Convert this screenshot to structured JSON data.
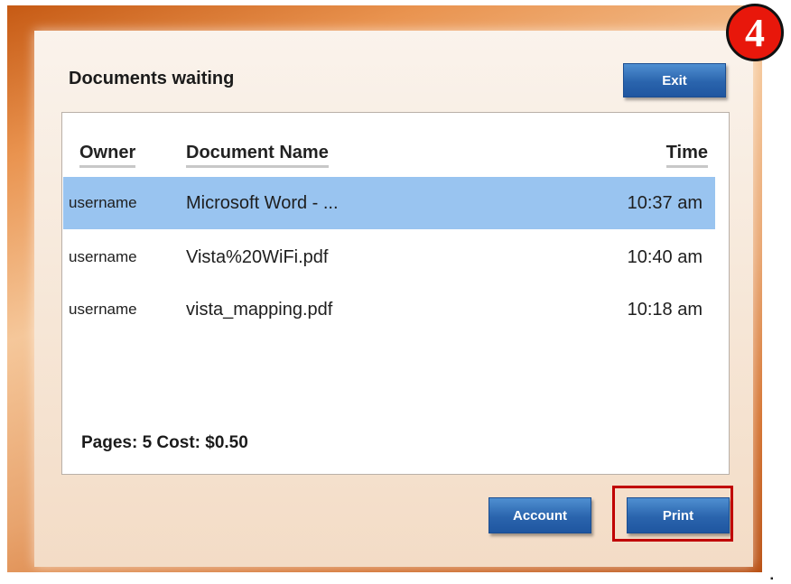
{
  "window": {
    "title": "Documents waiting",
    "step_number": "4"
  },
  "buttons": {
    "exit": "Exit",
    "account": "Account",
    "print": "Print"
  },
  "table": {
    "headers": {
      "owner": "Owner",
      "document": "Document Name",
      "time": "Time"
    },
    "rows": [
      {
        "owner": "username",
        "document": "Microsoft Word - ...",
        "time": "10:37 am",
        "selected": true
      },
      {
        "owner": "username",
        "document": "Vista%20WiFi.pdf",
        "time": "10:40 am",
        "selected": false
      },
      {
        "owner": "username",
        "document": "vista_mapping.pdf",
        "time": "10:18 am",
        "selected": false
      }
    ]
  },
  "summary": "Pages: 5 Cost: $0.50",
  "colors": {
    "selected_row": "#99c4f0",
    "button_blue": "#2a64ad",
    "highlight_red": "#c00000",
    "badge_red": "#e8170b"
  }
}
